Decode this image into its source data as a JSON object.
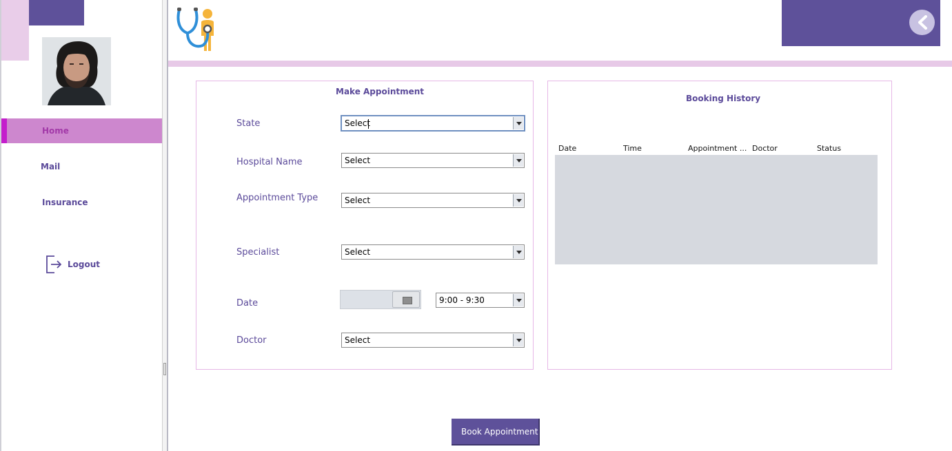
{
  "sidebar": {
    "items": [
      {
        "label": "Home"
      },
      {
        "label": "Mail"
      },
      {
        "label": "Insurance"
      }
    ],
    "logout_label": "Logout"
  },
  "form": {
    "title": "Make Appointment",
    "fields": [
      {
        "label": "State",
        "value": "Select"
      },
      {
        "label": "Hospital Name",
        "value": "Select"
      },
      {
        "label": "Appointment Type",
        "value": "Select"
      },
      {
        "label": "Specialist",
        "value": "Select"
      },
      {
        "label": "Date",
        "time_value": "9:00 - 9:30"
      },
      {
        "label": "Doctor",
        "value": "Select"
      }
    ]
  },
  "history": {
    "title": "Booking History",
    "columns": [
      "Date",
      "Time",
      "Appointment ...",
      "Doctor",
      "Status"
    ]
  },
  "book_button_label": "Book Appointment",
  "colors": {
    "accent": "#5e519a",
    "highlight": "#cd87ce",
    "pink_bar": "#e7c9e7"
  }
}
